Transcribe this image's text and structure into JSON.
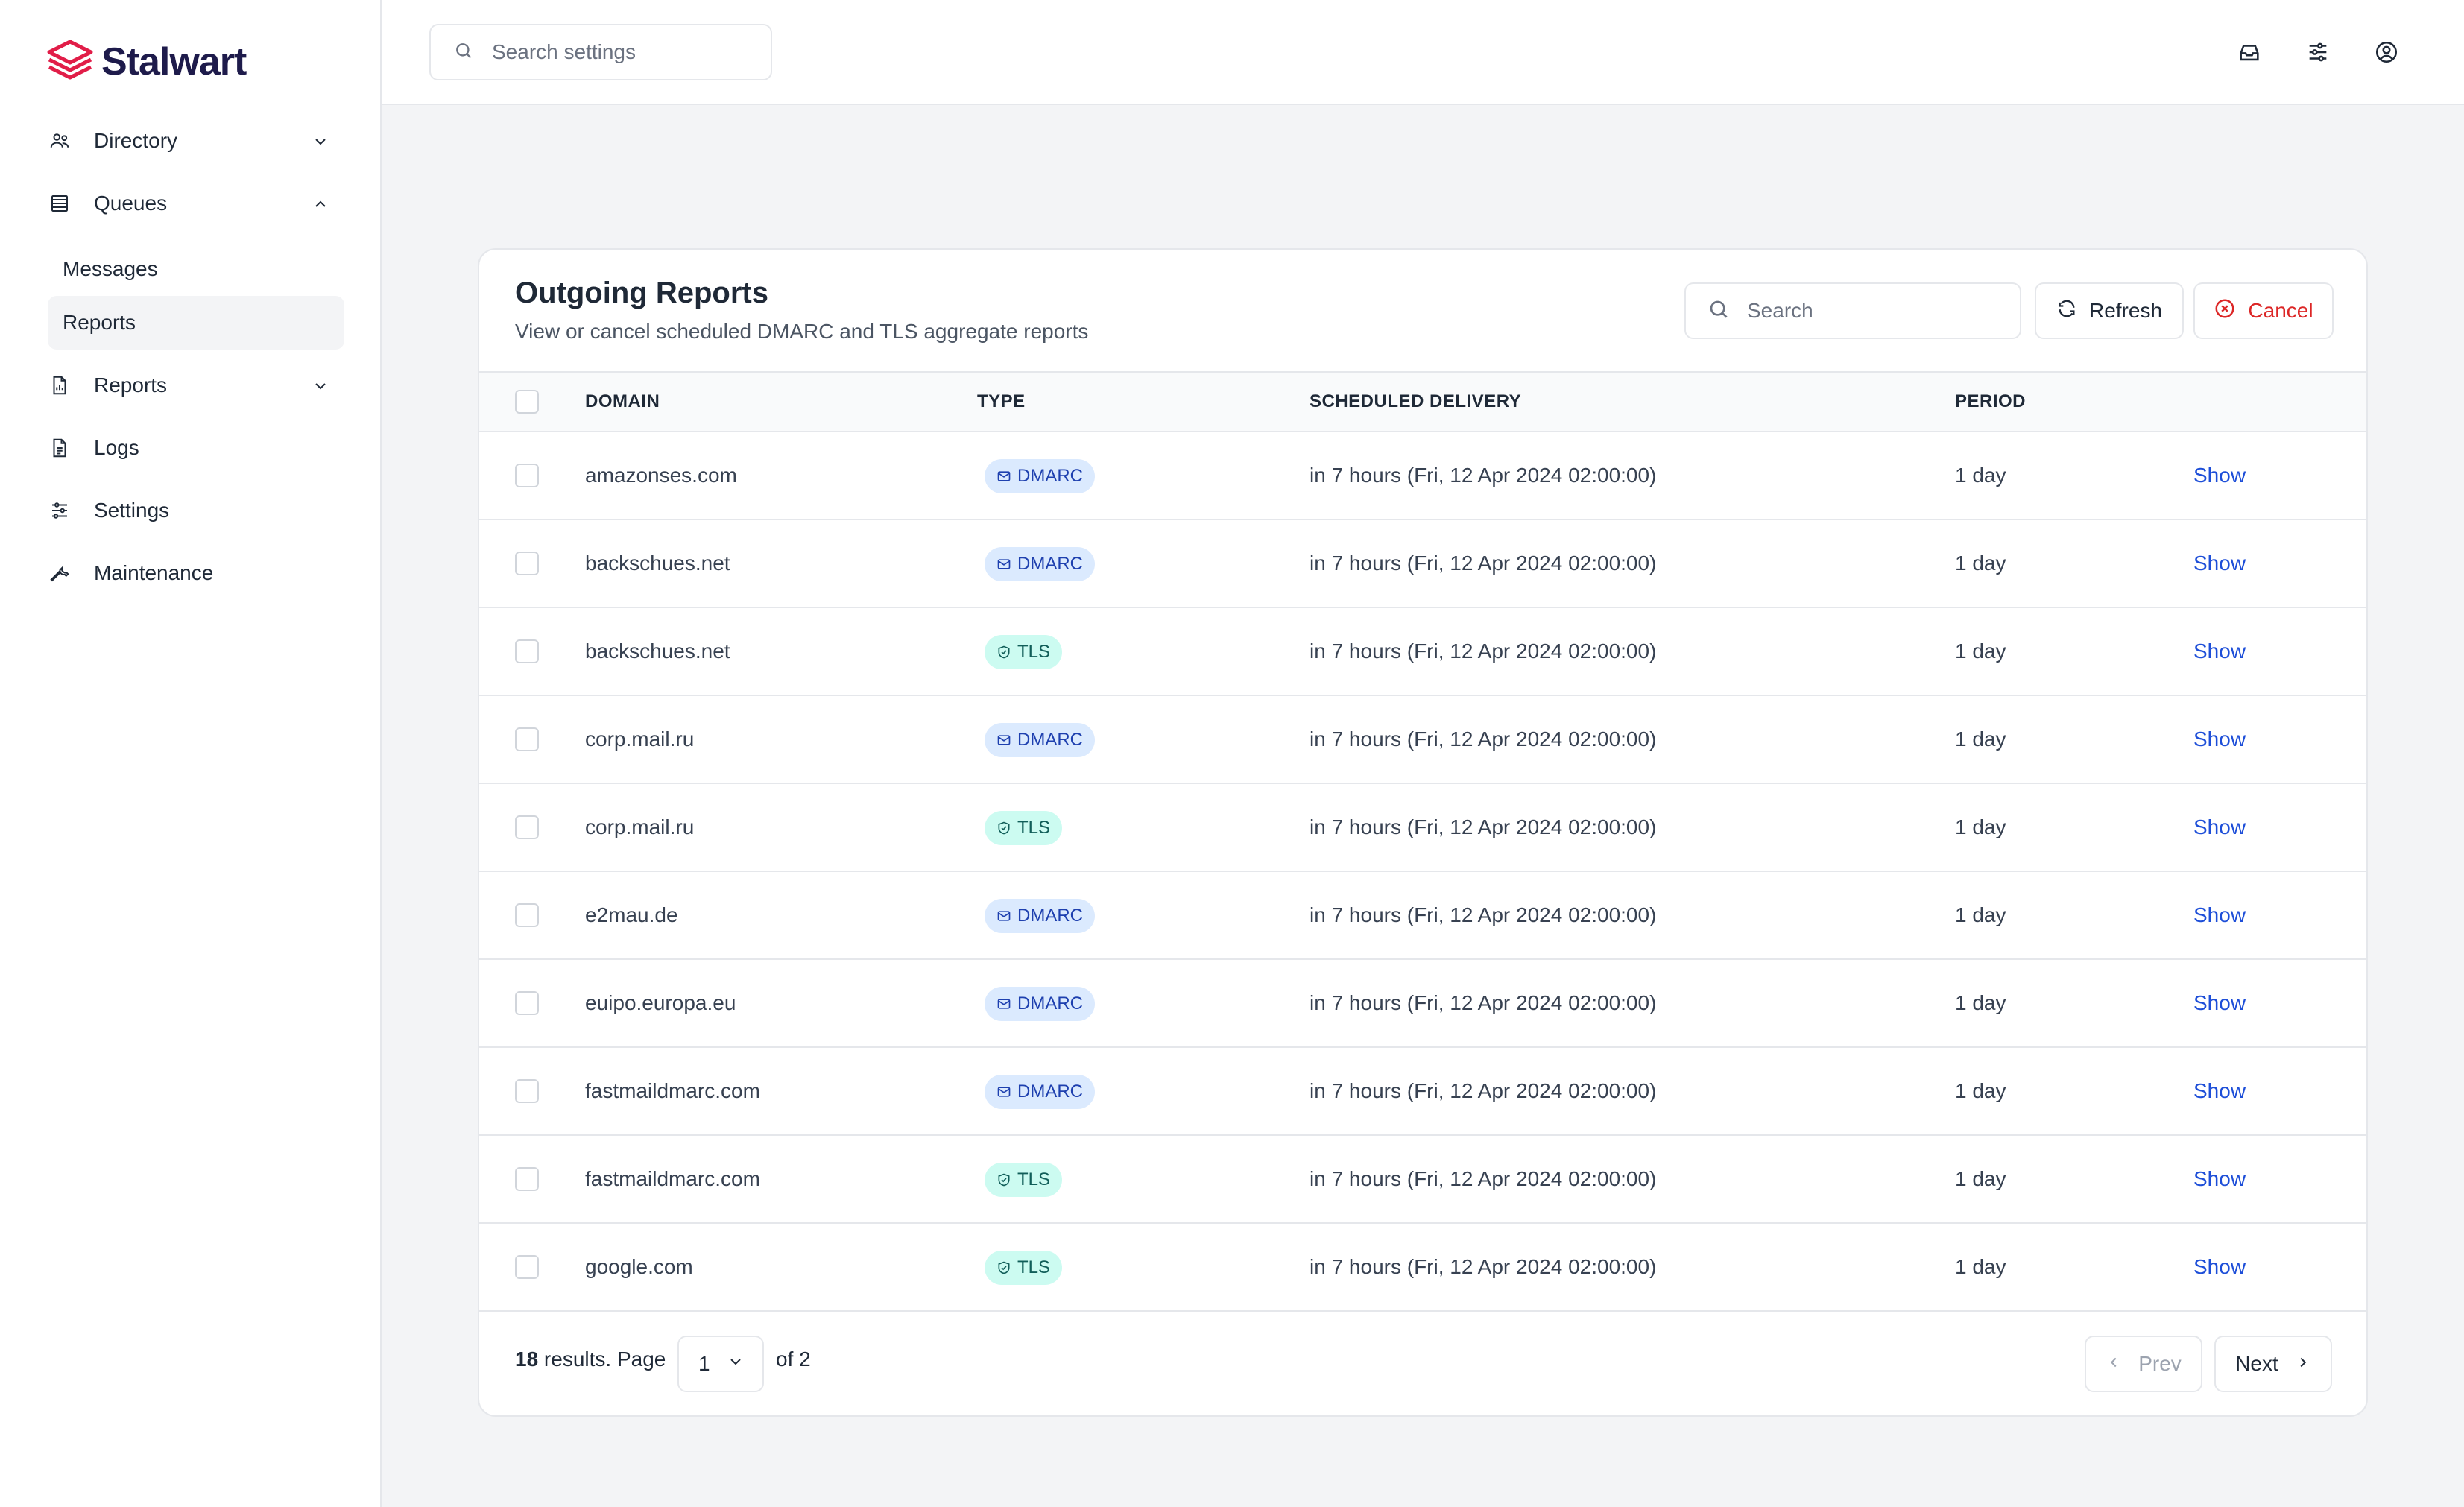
{
  "brand": {
    "name": "Stalwart",
    "accent": "#e11d48"
  },
  "sidebar": {
    "items": [
      {
        "label": "Directory",
        "icon": "users-icon",
        "expanded": false
      },
      {
        "label": "Queues",
        "icon": "queue-list-icon",
        "expanded": true
      },
      {
        "label": "Reports",
        "icon": "document-chart-icon",
        "expanded": false
      },
      {
        "label": "Logs",
        "icon": "document-text-icon"
      },
      {
        "label": "Settings",
        "icon": "sliders-icon"
      },
      {
        "label": "Maintenance",
        "icon": "wrench-icon"
      }
    ],
    "queues_sub": [
      {
        "label": "Messages",
        "active": false
      },
      {
        "label": "Reports",
        "active": true
      }
    ]
  },
  "topbar": {
    "search_placeholder": "Search settings",
    "icons": [
      "inbox-icon",
      "sliders-icon",
      "user-circle-icon"
    ]
  },
  "card": {
    "title": "Outgoing Reports",
    "subtitle": "View or cancel scheduled DMARC and TLS aggregate reports",
    "search_placeholder": "Search",
    "refresh_label": "Refresh",
    "cancel_label": "Cancel"
  },
  "table": {
    "headers": {
      "domain": "DOMAIN",
      "type": "TYPE",
      "scheduled": "SCHEDULED DELIVERY",
      "period": "PERIOD"
    },
    "rows": [
      {
        "domain": "amazonses.com",
        "type": "DMARC",
        "scheduled": "in 7 hours (Fri, 12 Apr 2024 02:00:00)",
        "period": "1 day",
        "action": "Show"
      },
      {
        "domain": "backschues.net",
        "type": "DMARC",
        "scheduled": "in 7 hours (Fri, 12 Apr 2024 02:00:00)",
        "period": "1 day",
        "action": "Show"
      },
      {
        "domain": "backschues.net",
        "type": "TLS",
        "scheduled": "in 7 hours (Fri, 12 Apr 2024 02:00:00)",
        "period": "1 day",
        "action": "Show"
      },
      {
        "domain": "corp.mail.ru",
        "type": "DMARC",
        "scheduled": "in 7 hours (Fri, 12 Apr 2024 02:00:00)",
        "period": "1 day",
        "action": "Show"
      },
      {
        "domain": "corp.mail.ru",
        "type": "TLS",
        "scheduled": "in 7 hours (Fri, 12 Apr 2024 02:00:00)",
        "period": "1 day",
        "action": "Show"
      },
      {
        "domain": "e2mau.de",
        "type": "DMARC",
        "scheduled": "in 7 hours (Fri, 12 Apr 2024 02:00:00)",
        "period": "1 day",
        "action": "Show"
      },
      {
        "domain": "euipo.europa.eu",
        "type": "DMARC",
        "scheduled": "in 7 hours (Fri, 12 Apr 2024 02:00:00)",
        "period": "1 day",
        "action": "Show"
      },
      {
        "domain": "fastmaildmarc.com",
        "type": "DMARC",
        "scheduled": "in 7 hours (Fri, 12 Apr 2024 02:00:00)",
        "period": "1 day",
        "action": "Show"
      },
      {
        "domain": "fastmaildmarc.com",
        "type": "TLS",
        "scheduled": "in 7 hours (Fri, 12 Apr 2024 02:00:00)",
        "period": "1 day",
        "action": "Show"
      },
      {
        "domain": "google.com",
        "type": "TLS",
        "scheduled": "in 7 hours (Fri, 12 Apr 2024 02:00:00)",
        "period": "1 day",
        "action": "Show"
      }
    ]
  },
  "pagination": {
    "results": "18",
    "results_suffix": " results. Page",
    "current_page": "1",
    "of_text": "of 2",
    "prev_label": "Prev",
    "next_label": "Next"
  }
}
